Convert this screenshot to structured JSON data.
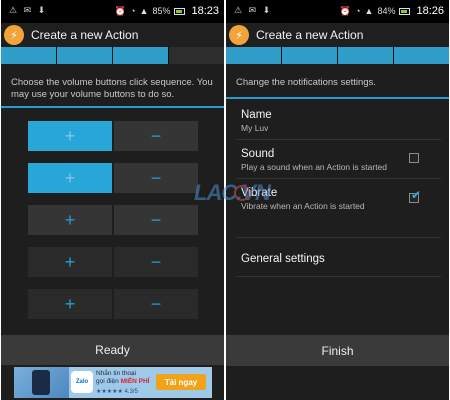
{
  "left": {
    "status": {
      "time": "18:23",
      "battery": "85%",
      "left_icons": "⚠ ✉ ⬇"
    },
    "title": "Create a new Action",
    "app_icon_glyph": "⚡",
    "progress": {
      "steps_total": 4,
      "current_step": 3
    },
    "hint": "Choose the volume buttons click sequence. You may use your volume buttons to do so.",
    "grid": {
      "rows": [
        {
          "up": "+",
          "down": "−",
          "up_state": "lit"
        },
        {
          "up": "+",
          "down": "−",
          "up_state": "lit"
        },
        {
          "up": "+",
          "down": "−",
          "up_state": "normal"
        },
        {
          "up": "+",
          "down": "−",
          "up_state": "dark"
        },
        {
          "up": "+",
          "down": "−",
          "up_state": "dark"
        }
      ]
    },
    "footer_button": "Ready",
    "ad": {
      "brand": "Zalo",
      "line1": "Nhắn tin thoại",
      "line2": "gọi điện",
      "highlight": "MIỄN PHÍ",
      "rating": "★★★★★ 4.3/5",
      "cta": "Tải ngay"
    }
  },
  "right": {
    "status": {
      "time": "18:26",
      "battery": "84%",
      "left_icons": "⚠ ✉ ⬇"
    },
    "title": "Create a new Action",
    "app_icon_glyph": "⚡",
    "progress": {
      "steps_total": 4,
      "current_step": 4
    },
    "hint": "Change the notifications settings.",
    "settings": [
      {
        "title": "Name",
        "subtitle": "My Luv",
        "has_checkbox": false
      },
      {
        "title": "Sound",
        "subtitle": "Play a sound when an Action is started",
        "has_checkbox": true,
        "checked": false
      },
      {
        "title": "Vibrate",
        "subtitle": "Vibrate when an Action is started",
        "has_checkbox": true,
        "checked": true
      },
      {
        "title": "General settings",
        "subtitle": "",
        "has_checkbox": false
      }
    ],
    "footer_button": "Finish"
  },
  "watermark": "LAC.VN",
  "colors": {
    "accent": "#2a9bcf",
    "background": "#1e1e1e",
    "bar": "#3a3a3a"
  }
}
